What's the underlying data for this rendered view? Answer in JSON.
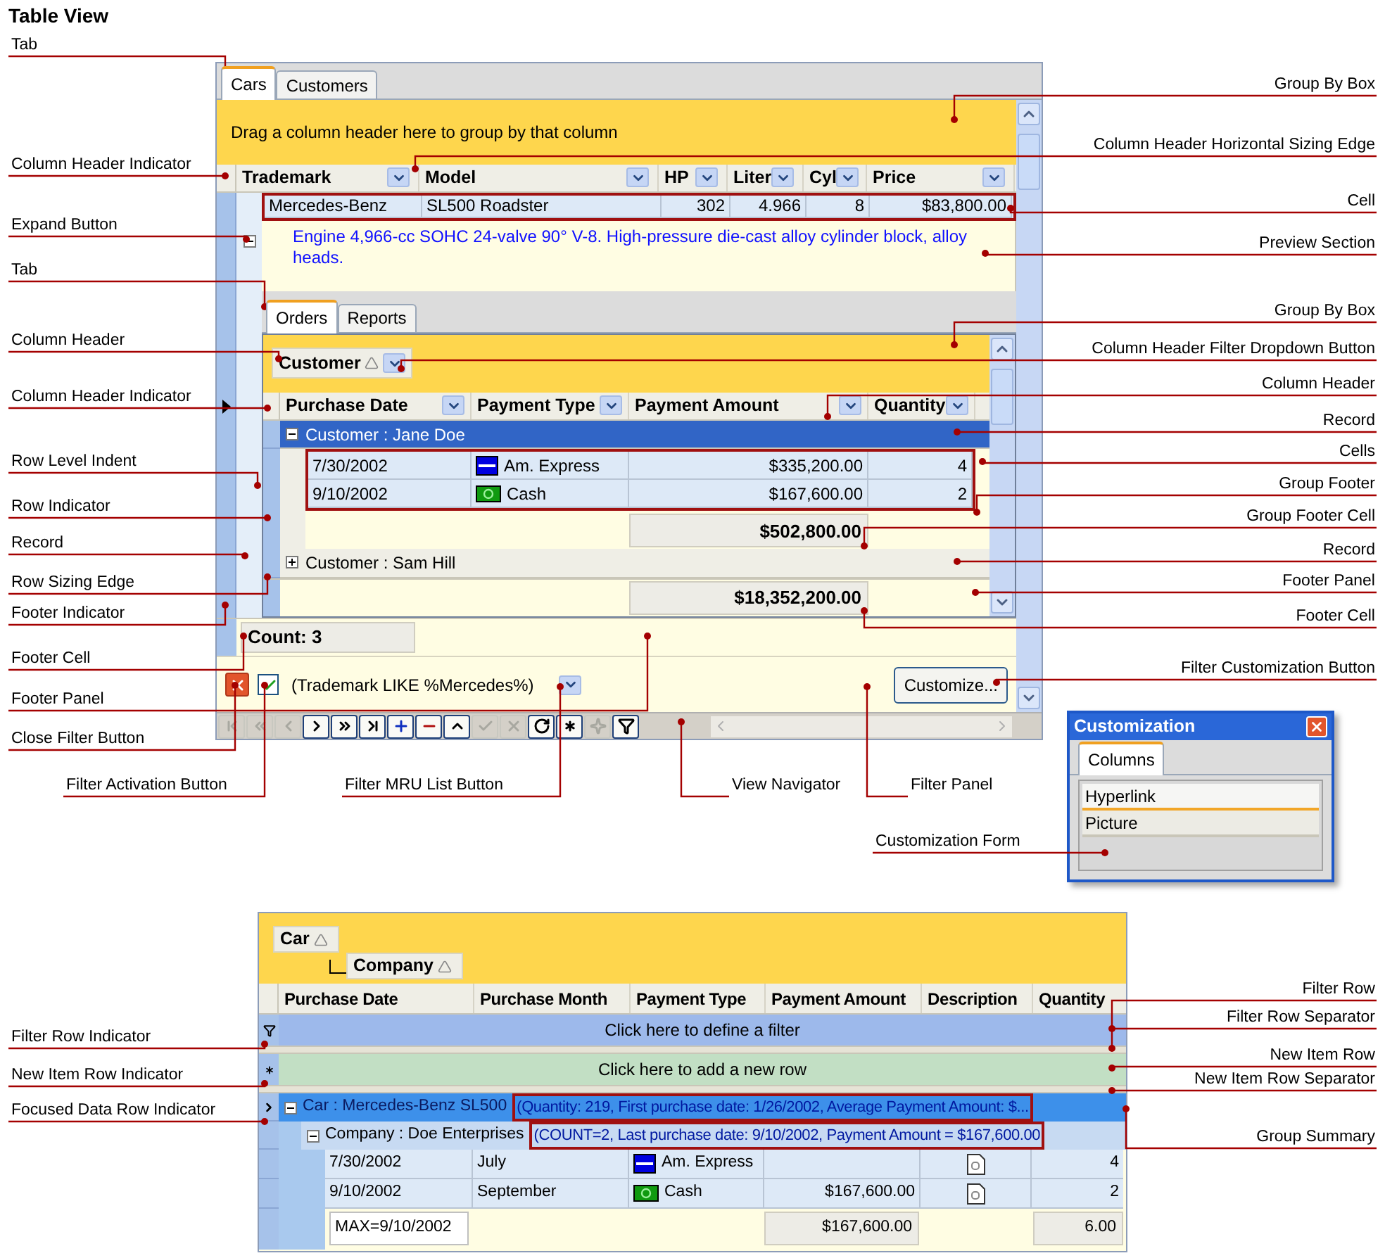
{
  "title": "Table View",
  "main_grid": {
    "tabs": [
      {
        "label": "Cars",
        "selected": true
      },
      {
        "label": "Customers",
        "selected": false
      }
    ],
    "group_by_hint": "Drag a column header here to group by that column",
    "columns": [
      "Trademark",
      "Model",
      "HP",
      "Liter",
      "Cyl",
      "Price"
    ],
    "record": {
      "expanded": true,
      "cells": [
        "Mercedes-Benz",
        "SL500 Roadster",
        "302",
        "4.966",
        "8",
        "$83,800.00"
      ],
      "preview": "Engine 4,966-cc SOHC 24-valve 90° V-8. High-pressure die-cast alloy cylinder block, alloy heads."
    },
    "detail": {
      "tabs": [
        {
          "label": "Orders",
          "selected": true
        },
        {
          "label": "Reports",
          "selected": false
        }
      ],
      "group_by": [
        {
          "label": "Customer"
        }
      ],
      "columns": [
        "Purchase Date",
        "Payment Type",
        "Payment Amount",
        "Quantity"
      ],
      "groups": [
        {
          "label": "Customer : Jane Doe",
          "expanded": true,
          "selected": true,
          "rows": [
            {
              "date": "7/30/2002",
              "payment": {
                "kind": "card",
                "label": "Am. Express"
              },
              "amount": "$335,200.00",
              "quantity": "4"
            },
            {
              "date": "9/10/2002",
              "payment": {
                "kind": "cash",
                "label": "Cash"
              },
              "amount": "$167,600.00",
              "quantity": "2"
            }
          ],
          "footer": "$502,800.00"
        },
        {
          "label": "Customer : Sam Hill",
          "expanded": false,
          "selected": false
        }
      ],
      "footer": "$18,352,200.00"
    },
    "footer_count": "Count: 3",
    "filter": {
      "active": true,
      "text": "(Trademark LIKE %Mercedes%)"
    },
    "customize_button": "Customize...",
    "navigator": [
      {
        "kind": "first",
        "disabled": true
      },
      {
        "kind": "prev_page",
        "disabled": true
      },
      {
        "kind": "prev",
        "disabled": true
      },
      {
        "kind": "next",
        "disabled": false
      },
      {
        "kind": "next_page",
        "disabled": false
      },
      {
        "kind": "last",
        "disabled": false
      },
      {
        "kind": "insert",
        "disabled": false
      },
      {
        "kind": "delete",
        "disabled": false
      },
      {
        "kind": "edit",
        "disabled": false
      },
      {
        "kind": "post",
        "disabled": true
      },
      {
        "kind": "cancel",
        "disabled": true
      },
      {
        "kind": "refresh",
        "disabled": false
      },
      {
        "kind": "bookmark",
        "disabled": false
      },
      {
        "kind": "goto_bookmark",
        "disabled": true
      },
      {
        "kind": "filter",
        "disabled": false
      }
    ]
  },
  "customization": {
    "title": "Customization",
    "tabs": [
      {
        "label": "Columns",
        "selected": true
      }
    ],
    "items": [
      "Hyperlink",
      "Picture"
    ]
  },
  "second_grid": {
    "group_by": [
      {
        "label": "Car"
      },
      {
        "label": "Company"
      }
    ],
    "columns": [
      "Purchase Date",
      "Purchase Month",
      "Payment Type",
      "Payment Amount",
      "Description",
      "Quantity"
    ],
    "filter_row": "Click here to define a filter",
    "new_row": "Click here to add a new row",
    "group": {
      "label": "Car : Mercedes-Benz SL500",
      "expanded": true,
      "summary": "(Quantity: 219, First purchase date: 1/26/2002, Average Payment Amount: $...",
      "subgroup": {
        "label": "Company : Doe Enterprises",
        "expanded": true,
        "summary": "(COUNT=2, Last purchase date: 9/10/2002, Payment Amount = $167,600.00",
        "rows": [
          {
            "date": "7/30/2002",
            "month": "July",
            "payment": {
              "kind": "card",
              "label": "Am. Express"
            },
            "amount": "",
            "quantity": "4"
          },
          {
            "date": "9/10/2002",
            "month": "September",
            "payment": {
              "kind": "cash",
              "label": "Cash"
            },
            "amount": "$167,600.00",
            "quantity": "2"
          }
        ],
        "footer": {
          "date": "MAX=9/10/2002",
          "amount": "$167,600.00",
          "quantity": "6.00"
        }
      }
    }
  },
  "callouts": [
    "Tab",
    "Column Header Indicator",
    "Expand Button",
    "Tab",
    "Column Header",
    "Column Header Indicator",
    "Row Level Indent",
    "Row Indicator",
    "Record",
    "Row Sizing Edge",
    "Footer Indicator",
    "Footer Cell",
    "Footer Panel",
    "Close Filter Button",
    "Filter Row Indicator",
    "New Item Row Indicator",
    "Focused Data Row Indicator",
    "Group By Box",
    "Column Header Horizontal Sizing Edge",
    "Cell",
    "Preview Section",
    "Group By Box",
    "Column Header Filter Dropdown Button",
    "Column Header",
    "Record",
    "Cells",
    "Group Footer",
    "Group Footer Cell",
    "Record",
    "Footer Panel",
    "Footer Cell",
    "Filter Customization Button",
    "Filter Row",
    "Filter Row Separator",
    "New Item Row",
    "New Item Row Separator",
    "Group Summary",
    "Filter Activation Button",
    "Filter MRU List Button",
    "View Navigator",
    "Filter Panel",
    "Customization Form"
  ]
}
